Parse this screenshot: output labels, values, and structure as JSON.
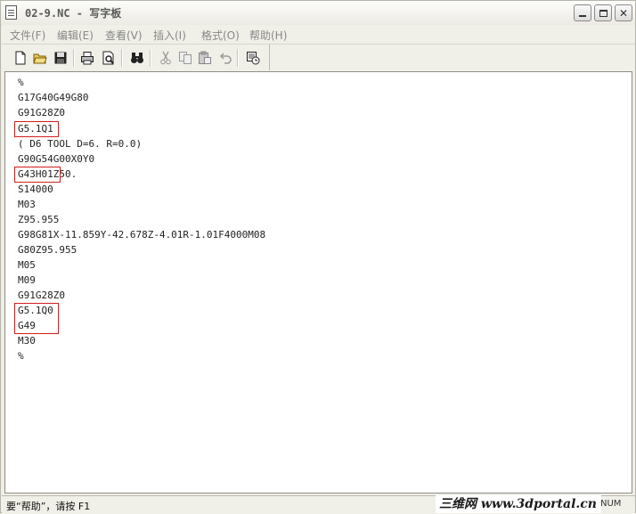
{
  "window": {
    "title": "02-9.NC - 写字板"
  },
  "menu": [
    {
      "label": "文件(F)"
    },
    {
      "label": "编辑(E)"
    },
    {
      "label": "查看(V)"
    },
    {
      "label": "插入(I)"
    },
    {
      "label": "格式(O)"
    },
    {
      "label": "帮助(H)"
    }
  ],
  "toolbar": [
    "new-document",
    "open-folder",
    "save",
    "print",
    "print-preview",
    "find",
    "cut",
    "copy",
    "paste",
    "undo",
    "insert-date-time"
  ],
  "document": {
    "lines": [
      "%",
      "G17G40G49G80",
      "G91G28Z0",
      "G5.1Q1",
      "( D6 TOOL D=6. R=0.0)",
      "G90G54G00X0Y0",
      "G43H01Z50.",
      "S14000",
      "M03",
      "Z95.955",
      "G98G81X-11.859Y-42.678Z-4.01R-1.01F4000M08",
      "G80Z95.955",
      "M05",
      "M09",
      "G91G28Z0",
      "G5.1Q0",
      "G49",
      "M30",
      "%"
    ]
  },
  "highlight_color": "#d21e1e",
  "status": {
    "help_text": "要“帮助”，请按 F1",
    "right_indicator": "NUM",
    "watermark": "三维网 www.3dportal.cn"
  }
}
